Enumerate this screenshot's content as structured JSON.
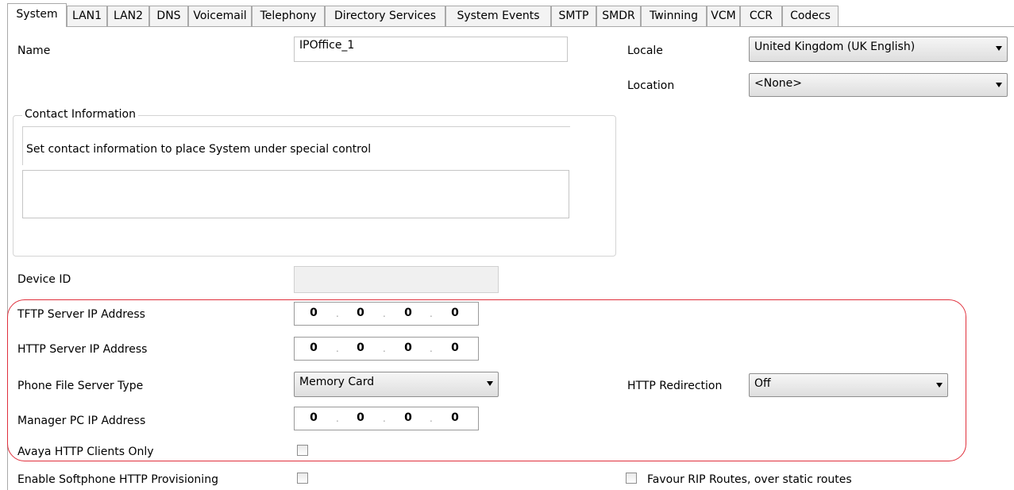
{
  "tabs": [
    {
      "label": "System"
    },
    {
      "label": "LAN1"
    },
    {
      "label": "LAN2"
    },
    {
      "label": "DNS"
    },
    {
      "label": "Voicemail"
    },
    {
      "label": "Telephony"
    },
    {
      "label": "Directory Services"
    },
    {
      "label": "System Events"
    },
    {
      "label": "SMTP"
    },
    {
      "label": "SMDR"
    },
    {
      "label": "Twinning"
    },
    {
      "label": "VCM"
    },
    {
      "label": "CCR"
    },
    {
      "label": "Codecs"
    }
  ],
  "name": {
    "label": "Name",
    "value": "IPOffice_1"
  },
  "locale": {
    "label": "Locale",
    "value": "United Kingdom (UK English)"
  },
  "location": {
    "label": "Location",
    "value": "<None>"
  },
  "contact": {
    "title": "Contact Information",
    "text": "Set contact information to place System under special control"
  },
  "device_id": {
    "label": "Device ID",
    "value": ""
  },
  "tftp": {
    "label": "TFTP Server IP Address",
    "octets": [
      "0",
      "0",
      "0",
      "0"
    ]
  },
  "http": {
    "label": "HTTP Server IP Address",
    "octets": [
      "0",
      "0",
      "0",
      "0"
    ]
  },
  "phone_file": {
    "label": "Phone File Server Type",
    "value": "Memory Card"
  },
  "http_redirect": {
    "label": "HTTP Redirection",
    "value": "Off"
  },
  "manager_pc": {
    "label": "Manager PC IP Address",
    "octets": [
      "0",
      "0",
      "0",
      "0"
    ]
  },
  "avaya_only": {
    "label": "Avaya HTTP Clients Only",
    "checked": false
  },
  "softphone": {
    "label": "Enable Softphone HTTP Provisioning",
    "checked": false
  },
  "favour_rip": {
    "label": "Favour RIP Routes, over static routes",
    "checked": false
  },
  "colors": {
    "highlight": "#e0303c",
    "border": "#a9a9a9"
  }
}
